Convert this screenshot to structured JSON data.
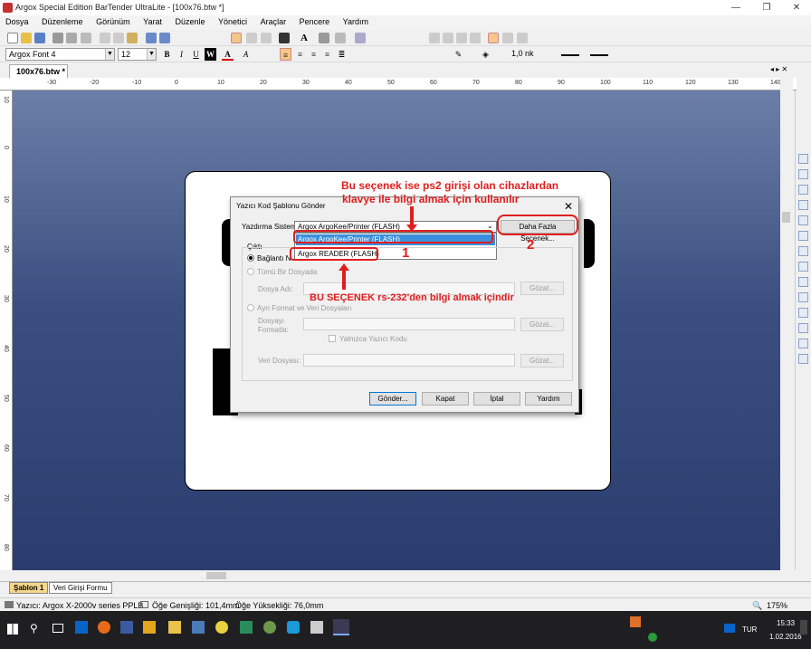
{
  "window": {
    "title": "Argox Special Edition BarTender UltraLite - [100x76.btw *]",
    "minimize": "—",
    "restore": "❐",
    "close": "✕"
  },
  "menu": [
    "Dosya",
    "Düzenleme",
    "Görünüm",
    "Yarat",
    "Düzenle",
    "Yönetici",
    "Araçlar",
    "Pencere",
    "Yardım"
  ],
  "format_toolbar": {
    "font": "Argox Font 4",
    "size": "12",
    "line_width": "1,0 nk"
  },
  "doc_tab": "100x76.btw *",
  "ruler_h": [
    "-30",
    "-20",
    "-10",
    "0",
    "10",
    "20",
    "30",
    "40",
    "50",
    "60",
    "70",
    "80",
    "90",
    "100",
    "110",
    "120",
    "130",
    "140"
  ],
  "ruler_v": [
    "10",
    "0",
    "10",
    "20",
    "30",
    "40",
    "50",
    "60",
    "70",
    "80",
    "90"
  ],
  "dialog": {
    "title": "Yazıcı Kod Şablonu Gönder",
    "printer_system_label": "Yazdırma Sistemi:",
    "printer_system_value": "Argox ArgoKee/Printer (FLASH)",
    "dropdown_options": [
      "Argox ArgoKee/Printer (FLASH)",
      "Argox READER (FLASH)"
    ],
    "more_options_button": "Daha Fazla Seçenek...",
    "output_group": "Çıktı",
    "radio_connected": "Bağlantı N",
    "radio_single_file": "Tümü Bir Dosyada",
    "file_name_label": "Dosya Adı:",
    "radio_separate": "Ayrı Format ve Veri Dosyaları",
    "format_file_label_1": "Dosyayı",
    "format_file_label_2": "Formatla:",
    "printer_code_only": "Yalnızca Yazıcı Kodu",
    "data_file_label": "Veri Dosyası:",
    "browse": "Gözat...",
    "send": "Gönder...",
    "close": "Kapat",
    "cancel": "İptal",
    "help": "Yardım"
  },
  "annotations": {
    "ps2_note_line1": "Bu seçenek ise ps2 girişi olan cihazlardan",
    "ps2_note_line2": "klavye ile bilgi almak için kullanılır",
    "rs232_note": "BU SEÇENEK rs-232'den bilgi almak içindir",
    "num1": "1",
    "num2": "2",
    "color": "#e01e1e"
  },
  "sheet_tabs": [
    "Şablon 1",
    "Veri Girişi Formu"
  ],
  "status": {
    "printer": "Yazıcı: Argox X-2000v series PPLB",
    "width": "Öğe Genişliği: 101,4mm",
    "height": "Öğe Yüksekliği: 76,0mm",
    "zoom": "175%"
  },
  "taskbar": {
    "lang": "TUR",
    "time": "15:33",
    "date": "1.02.2016"
  }
}
